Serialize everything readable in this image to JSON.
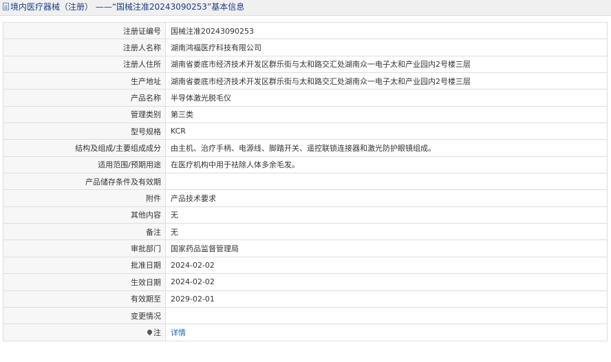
{
  "header": {
    "title": "境内医疗器械（注册） ——“国械注准20243090253”基本信息"
  },
  "rows": [
    {
      "label": "注册证编号",
      "value": "国械注准20243090253"
    },
    {
      "label": "注册人名称",
      "value": "湖南鸿福医疗科技有限公司"
    },
    {
      "label": "注册人住所",
      "value": "湖南省娄底市经济技术开发区群乐街与太和路交汇处湖南众一电子太和产业园内2号楼三层"
    },
    {
      "label": "生产地址",
      "value": "湖南省娄底市经济技术开发区群乐街与太和路交汇处湖南众一电子太和产业园内2号楼三层"
    },
    {
      "label": "产品名称",
      "value": "半导体激光脱毛仪"
    },
    {
      "label": "管理类别",
      "value": "第三类"
    },
    {
      "label": "型号规格",
      "value": "KCR"
    },
    {
      "label": "结构及组成/主要组成成分",
      "value": "由主机、治疗手柄、电源线、脚踏开关、遥控联锁连接器和激光防护眼镜组成。"
    },
    {
      "label": "适用范围/预期用途",
      "value": "在医疗机构中用于祛除人体多余毛发。"
    },
    {
      "label": "产品储存条件及有效期",
      "value": ""
    },
    {
      "label": "附件",
      "value": "产品技术要求"
    },
    {
      "label": "其他内容",
      "value": "无"
    },
    {
      "label": "备注",
      "value": "无"
    },
    {
      "label": "审批部门",
      "value": "国家药品监督管理局"
    },
    {
      "label": "批准日期",
      "value": "2024-02-02"
    },
    {
      "label": "生效日期",
      "value": "2024-02-02"
    },
    {
      "label": "有效期至",
      "value": "2029-02-01"
    },
    {
      "label": "变更情况",
      "value": ""
    }
  ],
  "note": {
    "label": "注",
    "link_text": "详情",
    "icon": "pin-icon"
  }
}
